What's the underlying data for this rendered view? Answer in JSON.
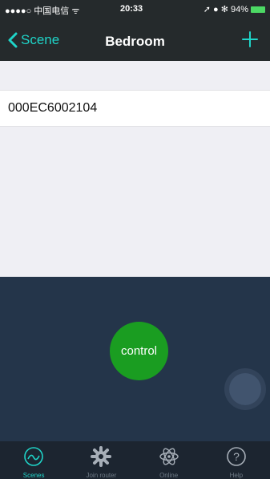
{
  "status_bar": {
    "carrier": "●●●●○ 中国电信 ᯤ",
    "time": "20:33",
    "right": "➚ ● ✻ 94%"
  },
  "nav": {
    "back_label": "Scene",
    "title": "Bedroom",
    "add_icon": "plus-icon"
  },
  "devices": [
    {
      "id": "000EC6002104"
    }
  ],
  "control": {
    "button_label": "control"
  },
  "tabs": [
    {
      "label": "Scenes",
      "icon": "scenes-icon",
      "active": true
    },
    {
      "label": "Join router",
      "icon": "gear-icon",
      "active": false
    },
    {
      "label": "Online",
      "icon": "atom-icon",
      "active": false
    },
    {
      "label": "Help",
      "icon": "help-icon",
      "active": false
    }
  ],
  "colors": {
    "accent": "#1fd4c8",
    "control_green": "#1a9d21",
    "panel": "#24354a",
    "header": "#252a2c"
  }
}
